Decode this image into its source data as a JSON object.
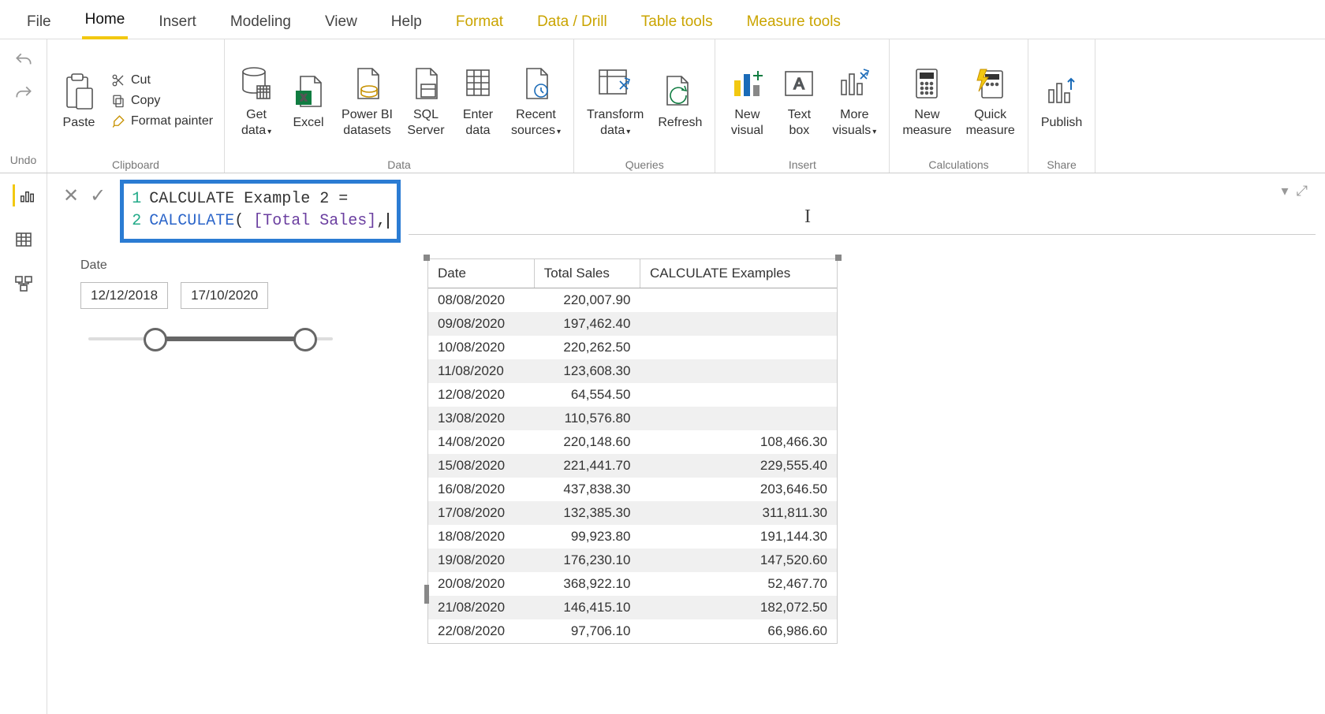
{
  "tabs": {
    "file": "File",
    "home": "Home",
    "insert": "Insert",
    "modeling": "Modeling",
    "view": "View",
    "help": "Help",
    "format": "Format",
    "datadrill": "Data / Drill",
    "tabletools": "Table tools",
    "measuretools": "Measure tools"
  },
  "undo_group": {
    "label": "Undo"
  },
  "ribbon": {
    "clipboard": {
      "label": "Clipboard",
      "paste": "Paste",
      "cut": "Cut",
      "copy": "Copy",
      "format_painter": "Format painter"
    },
    "data": {
      "label": "Data",
      "get_data": "Get\ndata",
      "excel": "Excel",
      "pbi_datasets": "Power BI\ndatasets",
      "sql_server": "SQL\nServer",
      "enter_data": "Enter\ndata",
      "recent_sources": "Recent\nsources"
    },
    "queries": {
      "label": "Queries",
      "transform": "Transform\ndata",
      "refresh": "Refresh"
    },
    "insert": {
      "label": "Insert",
      "new_visual": "New\nvisual",
      "text_box": "Text\nbox",
      "more_visuals": "More\nvisuals"
    },
    "calculations": {
      "label": "Calculations",
      "new_measure": "New\nmeasure",
      "quick_measure": "Quick\nmeasure"
    },
    "share": {
      "label": "Share",
      "publish": "Publish"
    }
  },
  "formula": {
    "line1_num": "1",
    "line1_text": "CALCULATE Example 2 =",
    "line2_num": "2",
    "line2_fn": "CALCULATE",
    "line2_open": "( ",
    "line2_measure": "[Total Sales]",
    "line2_tail": ","
  },
  "slicer": {
    "title": "Date",
    "from": "12/12/2018",
    "to": "17/10/2020"
  },
  "table": {
    "headers": {
      "date": "Date",
      "sales": "Total Sales",
      "calc": "CALCULATE Examples"
    },
    "rows": [
      {
        "date": "08/08/2020",
        "sales": "220,007.90",
        "calc": ""
      },
      {
        "date": "09/08/2020",
        "sales": "197,462.40",
        "calc": ""
      },
      {
        "date": "10/08/2020",
        "sales": "220,262.50",
        "calc": ""
      },
      {
        "date": "11/08/2020",
        "sales": "123,608.30",
        "calc": ""
      },
      {
        "date": "12/08/2020",
        "sales": "64,554.50",
        "calc": ""
      },
      {
        "date": "13/08/2020",
        "sales": "110,576.80",
        "calc": ""
      },
      {
        "date": "14/08/2020",
        "sales": "220,148.60",
        "calc": "108,466.30"
      },
      {
        "date": "15/08/2020",
        "sales": "221,441.70",
        "calc": "229,555.40"
      },
      {
        "date": "16/08/2020",
        "sales": "437,838.30",
        "calc": "203,646.50"
      },
      {
        "date": "17/08/2020",
        "sales": "132,385.30",
        "calc": "311,811.30"
      },
      {
        "date": "18/08/2020",
        "sales": "99,923.80",
        "calc": "191,144.30"
      },
      {
        "date": "19/08/2020",
        "sales": "176,230.10",
        "calc": "147,520.60"
      },
      {
        "date": "20/08/2020",
        "sales": "368,922.10",
        "calc": "52,467.70"
      },
      {
        "date": "21/08/2020",
        "sales": "146,415.10",
        "calc": "182,072.50"
      },
      {
        "date": "22/08/2020",
        "sales": "97,706.10",
        "calc": "66,986.60"
      }
    ]
  }
}
